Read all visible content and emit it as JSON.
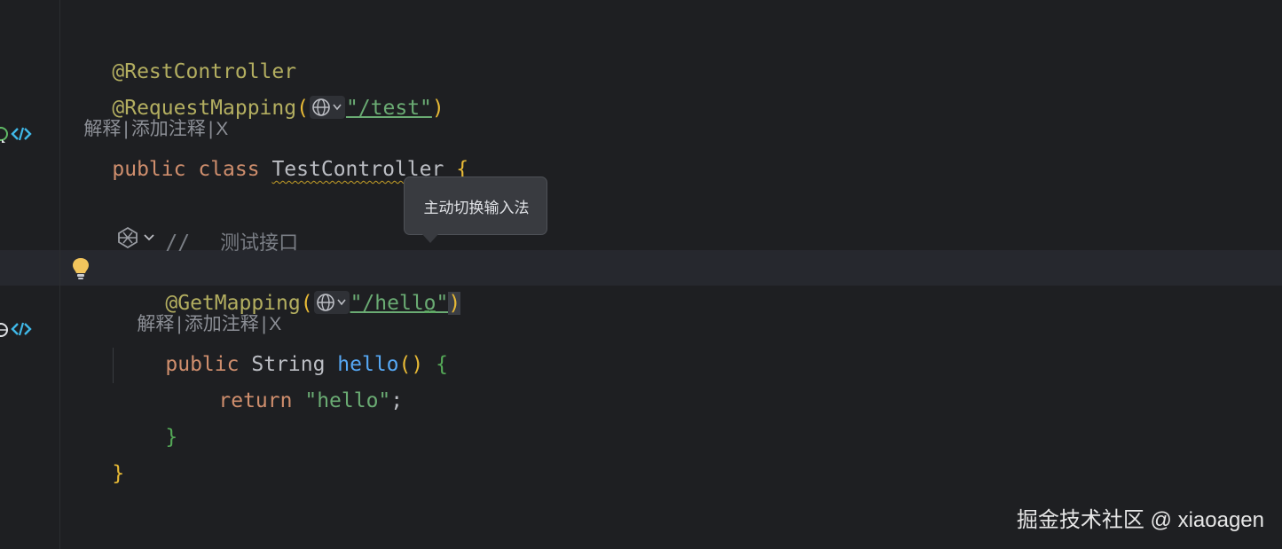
{
  "code": {
    "annotation_rest": "@RestController",
    "annotation_request": "@RequestMapping",
    "request_path": "\"/test\"",
    "lens_explain": "解释",
    "lens_add_comment": "添加注释",
    "lens_close": "X",
    "kw_public": "public",
    "kw_class": "class",
    "class_name": "TestController",
    "open_brace": "{",
    "comment_slashes": "//",
    "comment_text": "测试接口",
    "annotation_get": "@GetMapping",
    "get_path": "\"/hello\"",
    "paren_open": "(",
    "paren_close": ")",
    "type_string": "String",
    "method_name": "hello",
    "method_parens": "()",
    "kw_return": "return",
    "return_value": "\"hello\"",
    "semicolon": ";",
    "close_brace": "}",
    "eq_marker": "=="
  },
  "tooltip": {
    "text": "主动切换输入法"
  },
  "watermark": "掘金技术社区 @ xiaoagen",
  "icons": {
    "globe": "globe-icon",
    "chevron": "chevron-down-icon",
    "bulb": "lightbulb-icon",
    "endpoint": "web-endpoint-icon",
    "ai": "ai-assistant-icon"
  },
  "colors": {
    "background": "#1e1f22",
    "annotation": "#b3ae60",
    "string": "#6aab73",
    "keyword": "#cf8e6d",
    "function": "#56a8f5",
    "comment": "#7a7e85"
  }
}
